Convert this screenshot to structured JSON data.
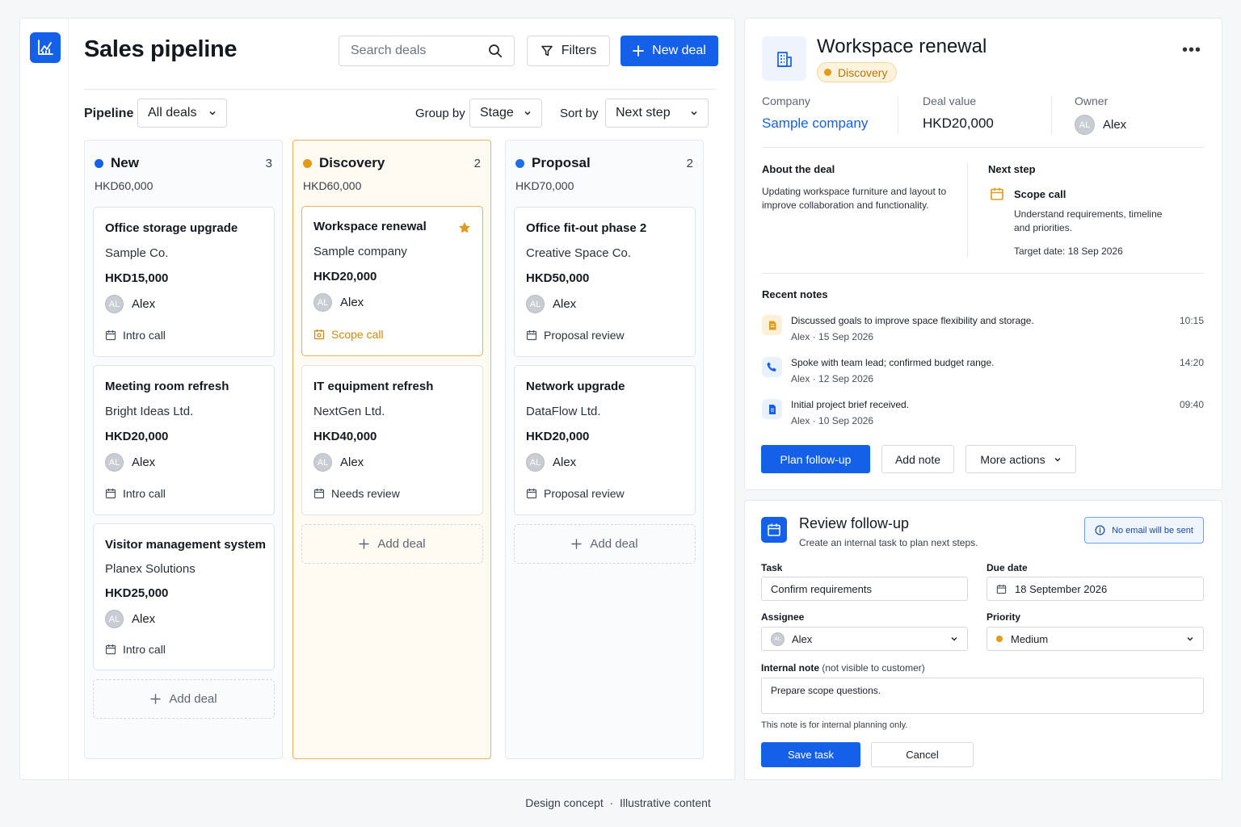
{
  "app": {
    "title": "Sales pipeline",
    "search_placeholder": "Search deals",
    "filters_label": "Filters",
    "new_deal_label": "New deal"
  },
  "filters": {
    "pipeline_label": "Pipeline",
    "pipeline_value": "All deals",
    "group_label": "Group by",
    "group_value": "Stage",
    "sort_label": "Sort by",
    "sort_value": "Next step"
  },
  "columns": [
    {
      "name": "New",
      "count": "3",
      "total": "HKD60,000",
      "dot_color": "#1460e8",
      "deals": [
        {
          "title": "Office storage upgrade",
          "company": "Sample Co.",
          "value": "HKD15,000",
          "initials": "AL",
          "owner": "Alex",
          "step": "Intro call"
        },
        {
          "title": "Meeting room refresh",
          "company": "Bright Ideas Ltd.",
          "value": "HKD20,000",
          "initials": "AL",
          "owner": "Alex",
          "step": "Intro call"
        },
        {
          "title": "Visitor management system",
          "company": "Planex Solutions",
          "value": "HKD25,000",
          "initials": "AL",
          "owner": "Alex",
          "step": "Intro call"
        }
      ],
      "add_label": "Add deal"
    },
    {
      "name": "Discovery",
      "count": "2",
      "total": "HKD60,000",
      "dot_color": "#e29a1a",
      "deals": [
        {
          "title": "Workspace renewal",
          "company": "Sample company",
          "value": "HKD20,000",
          "initials": "AL",
          "owner": "Alex",
          "step": "Scope call"
        },
        {
          "title": "IT equipment refresh",
          "company": "NextGen Ltd.",
          "value": "HKD40,000",
          "initials": "AL",
          "owner": "Alex",
          "step": "Needs review"
        }
      ],
      "add_label": "Add deal"
    },
    {
      "name": "Proposal",
      "count": "2",
      "total": "HKD70,000",
      "dot_color": "#1f6ee8",
      "deals": [
        {
          "title": "Office fit-out phase 2",
          "company": "Creative Space Co.",
          "value": "HKD50,000",
          "initials": "AL",
          "owner": "Alex",
          "step": "Proposal review"
        },
        {
          "title": "Network upgrade",
          "company": "DataFlow Ltd.",
          "value": "HKD20,000",
          "initials": "AL",
          "owner": "Alex",
          "step": "Proposal review"
        }
      ],
      "add_label": "Add deal"
    }
  ],
  "detail": {
    "title": "Workspace renewal",
    "stage": "Discovery",
    "company_label": "Company",
    "company_value": "Sample company",
    "value_label": "Deal value",
    "value_value": "HKD20,000",
    "owner_label": "Owner",
    "owner_initials": "AL",
    "owner_value": "Alex",
    "about_title": "About the deal",
    "about_text": "Updating workspace furniture and layout to improve collaboration and functionality.",
    "next_title": "Next step",
    "next_name": "Scope call",
    "next_desc": "Understand requirements, timeline and priorities.",
    "next_target": "Target date: 18 Sep 2026",
    "notes_title": "Recent notes",
    "notes": [
      {
        "text": "Discussed goals to improve space flexibility and storage.",
        "author": "Alex",
        "date": "15 Sep 2026",
        "time": "10:15",
        "icon": "note-icon"
      },
      {
        "text": "Spoke with team lead; confirmed budget range.",
        "author": "Alex",
        "date": "12 Sep 2026",
        "time": "14:20",
        "icon": "phone-icon"
      },
      {
        "text": "Initial project brief received.",
        "author": "Alex",
        "date": "10 Sep 2026",
        "time": "09:40",
        "icon": "document-icon"
      }
    ],
    "plan_label": "Plan follow-up",
    "add_note_label": "Add note",
    "more_actions_label": "More actions"
  },
  "form": {
    "title": "Review follow-up",
    "subtitle": "Create an internal task to plan next steps.",
    "info": "No email will be sent",
    "task_label": "Task",
    "task_value": "Confirm requirements",
    "due_label": "Due date",
    "due_value": "18 September 2026",
    "assignee_label": "Assignee",
    "assignee_initials": "AL",
    "assignee_value": "Alex",
    "priority_label": "Priority",
    "priority_value": "Medium",
    "note_label": "Internal note",
    "note_label_hint": "(not visible to customer)",
    "note_value": "Prepare scope questions.",
    "note_hint": "This note is for internal planning only.",
    "save_label": "Save task",
    "cancel_label": "Cancel"
  },
  "footer": {
    "left": "Design concept",
    "sep": "·",
    "right": "Illustrative content"
  },
  "colors": {
    "accent": "#1460e8",
    "discovery": "#e29a1a"
  }
}
